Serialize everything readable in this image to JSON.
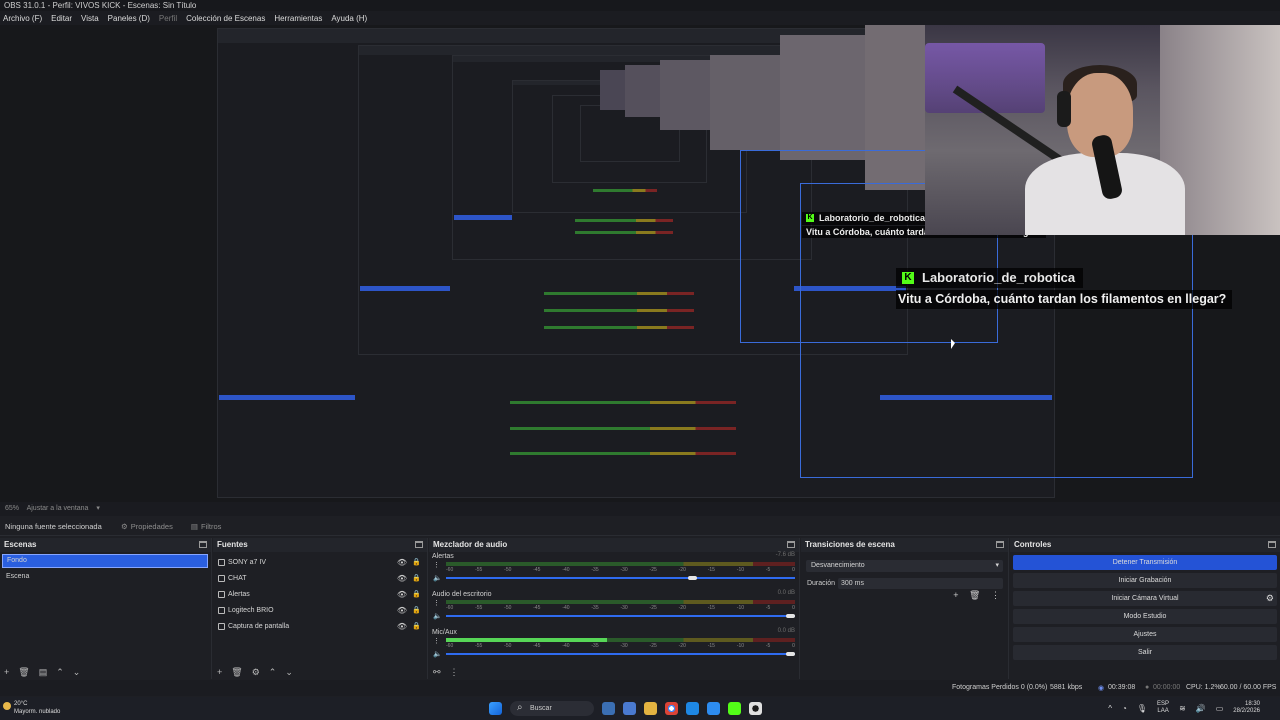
{
  "window": {
    "title": "OBS 31.0.1 - Perfil: VIVOS KICK - Escenas: Sin Título"
  },
  "menu": [
    "Archivo (F)",
    "Editar",
    "Vista",
    "Paneles (D)",
    "Perfil",
    "Colección de Escenas",
    "Herramientas",
    "Ayuda (H)"
  ],
  "chat": {
    "username": "Laboratorio_de_robotica",
    "message": "Vitu a Córdoba, cuánto tardan los filamentos en llegar?",
    "badge": "K"
  },
  "zoom": {
    "percent": "65%",
    "fit_label": "Ajustar a la ventana"
  },
  "properties_bar": {
    "no_selection": "Ninguna fuente seleccionada",
    "properties": "Propiedades",
    "filters": "Filtros"
  },
  "scenes": {
    "title": "Escenas",
    "items": [
      "Fondo",
      "Escena"
    ],
    "selected": "Fondo"
  },
  "sources": {
    "title": "Fuentes",
    "items": [
      "SONY a7 IV",
      "CHAT",
      "Alertas",
      "Logitech BRIO",
      "Captura de pantalla"
    ]
  },
  "mixer": {
    "title": "Mezclador de audio",
    "ticks": [
      "-60",
      "-55",
      "-50",
      "-45",
      "-40",
      "-35",
      "-30",
      "-25",
      "-20",
      "-15",
      "-10",
      "-5",
      "0"
    ],
    "channels": [
      {
        "name": "Alertas",
        "db": "-7.6 dB",
        "level": 0,
        "fader": 0.72
      },
      {
        "name": "Audio del escritorio",
        "db": "0.0 dB",
        "level": 0,
        "fader": 1.0
      },
      {
        "name": "Mic/Aux",
        "db": "0.0 dB",
        "level": 0.46,
        "fader": 1.0
      }
    ]
  },
  "transitions": {
    "title": "Transiciones de escena",
    "selected": "Desvanecimiento",
    "duration_label": "Duración",
    "duration": "300 ms"
  },
  "controls": {
    "title": "Controles",
    "buttons": [
      "Detener Transmisión",
      "Iniciar Grabación",
      "Iniciar Cámara Virtual",
      "Modo Estudio",
      "Ajustes",
      "Salir"
    ]
  },
  "status": {
    "dropped": "Fotogramas Perdidos 0 (0.0%)",
    "bitrate": "5881 kbps",
    "live_time": "00:39:08",
    "rec_time": "00:00:00",
    "cpu": "CPU: 1.2%",
    "fps": "60.00 / 60.00 FPS"
  },
  "taskbar": {
    "weather_temp": "20°C",
    "weather_desc": "Mayorm. nublado",
    "search": "Buscar",
    "lang_top": "ESP",
    "lang_bottom": "LAA",
    "time": "18:30",
    "date": "28/2/2026"
  },
  "colors": {
    "accent": "#2453d6",
    "kick_green": "#53fc18",
    "meter_green": "#57d657"
  }
}
